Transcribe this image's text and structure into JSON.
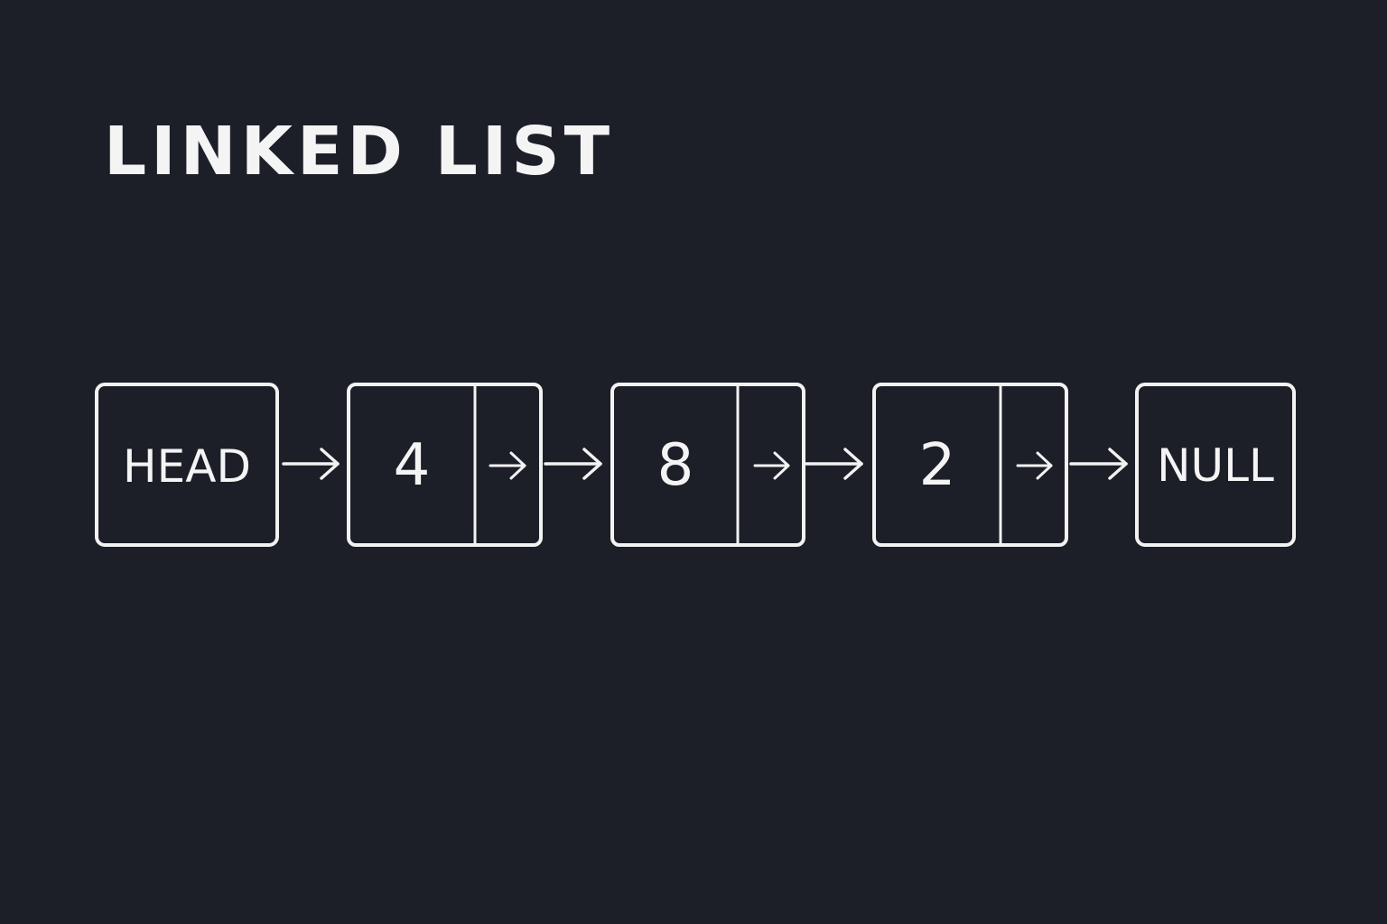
{
  "title": "LINKED LIST",
  "head": {
    "label": "HEAD"
  },
  "nodes": [
    {
      "value": "4"
    },
    {
      "value": "8"
    },
    {
      "value": "2"
    }
  ],
  "terminal": {
    "label": "NULL"
  },
  "colors": {
    "background": "#1c1f28",
    "foreground": "#f2f2f2"
  }
}
